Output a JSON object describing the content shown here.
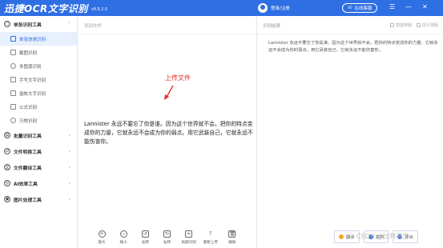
{
  "app": {
    "title": "迅捷OCR文字识别",
    "version": "v8.8.2.0"
  },
  "header": {
    "login": "登录/注册",
    "online": "在线客服"
  },
  "sidebar": {
    "groups": [
      {
        "label": "单张识别工具",
        "items": [
          "单张快速识别",
          "截图识别",
          "多图源识别",
          "手写文字识别",
          "滥帐文字识别",
          "公式识别",
          "万物识别"
        ]
      },
      {
        "label": "批量识别工具"
      },
      {
        "label": "文件转换工具"
      },
      {
        "label": "文件翻译工具"
      },
      {
        "label": "AI效率工具"
      },
      {
        "label": "图片处理工具"
      }
    ]
  },
  "left": {
    "title": "识别文件",
    "upload_label": "上传文件",
    "text": "Lannister 永远不要忘了你是谁。因为这个世界就不会。把你的特点变成你的力量，它就永远不会成为你的弱点。用它武装自己，它就永远不能伤害你。",
    "toolbar": [
      "放大",
      "缩小",
      "左转",
      "右转",
      "局部识别",
      "重新上传",
      "删除"
    ]
  },
  "right": {
    "title": "识别结果",
    "actions": [
      "智能排版",
      "段行排版"
    ],
    "text": "Lannister 永远不要忘了你是谁。因为这个世界就不会。把你的特点变成你的力量，它就永远不会成为你的弱点。用它武装自己，它就永远不能伤害你。",
    "buttons": [
      "翻译",
      "复制",
      "导出"
    ]
  },
  "watermark": "CSDN @比特寻宝"
}
